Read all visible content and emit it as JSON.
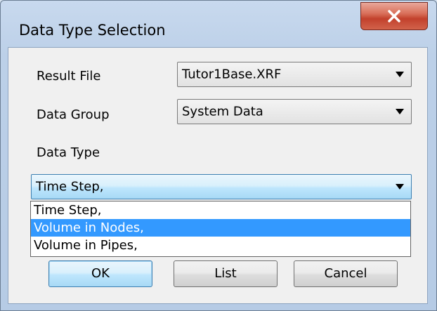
{
  "window": {
    "title": "Data Type Selection",
    "close_icon": "close-icon"
  },
  "form": {
    "result_file": {
      "label": "Result File",
      "value": "Tutor1Base.XRF"
    },
    "data_group": {
      "label": "Data Group",
      "value": "System Data"
    },
    "data_type": {
      "label": "Data Type",
      "value": "Time Step,",
      "options": [
        "Time Step,",
        "Volume in Nodes,",
        "Volume in Pipes,"
      ],
      "highlighted": "Volume in Nodes,"
    }
  },
  "buttons": {
    "ok": "OK",
    "list": "List",
    "cancel": "Cancel"
  },
  "colors": {
    "selection": "#3399ff",
    "close_button": "#c2412c",
    "focus_border": "#3c7fb1"
  }
}
